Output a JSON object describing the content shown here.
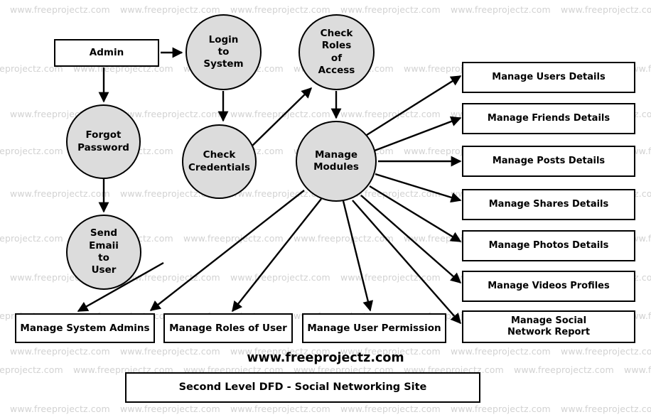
{
  "diagram": {
    "title": "Second Level DFD - Social Networking Site",
    "brand": "www.freeprojectz.com",
    "watermark_text": "www.freeprojectz.com",
    "colors": {
      "process_fill": "#dcdcdc",
      "stroke": "#000000",
      "background": "#ffffff",
      "watermark": "#d2d2d2"
    }
  },
  "nodes": {
    "admin": "Admin",
    "login_to_system": "Login\nto\nSystem",
    "check_roles_of_access": "Check\nRoles\nof\nAccess",
    "forgot_password": "Forgot\nPassword",
    "check_credentials": "Check\nCredentials",
    "manage_modules": "Manage\nModules",
    "send_email_to_user": "Send\nEmaii\nto\nUser"
  },
  "data_stores_right": [
    {
      "label": "Manage Users Details"
    },
    {
      "label": "Manage Friends Details"
    },
    {
      "label": "Manage Posts Details"
    },
    {
      "label": "Manage Shares Details"
    },
    {
      "label": "Manage Photos Details"
    },
    {
      "label": "Manage Videos Profiles"
    },
    {
      "label": "Manage Social\nNetwork Report"
    }
  ],
  "data_stores_bottom": [
    {
      "label": "Manage System Admins"
    },
    {
      "label": "Manage Roles of User"
    },
    {
      "label": "Manage User Permission"
    }
  ],
  "chart_data": {
    "type": "table",
    "title": "Second Level DFD - Social Networking Site",
    "processes": [
      "Login to System",
      "Check Roles of Access",
      "Forgot Password",
      "Check Credentials",
      "Manage Modules",
      "Send Emaii to User"
    ],
    "external_entities": [
      "Admin"
    ],
    "data_stores": [
      "Manage Users Details",
      "Manage Friends Details",
      "Manage Posts Details",
      "Manage Shares Details",
      "Manage Photos Details",
      "Manage Videos Profiles",
      "Manage Social Network Report",
      "Manage System Admins",
      "Manage Roles of User",
      "Manage User Permission"
    ],
    "flows": [
      {
        "from": "Admin",
        "to": "Login to System"
      },
      {
        "from": "Admin",
        "to": "Forgot Password"
      },
      {
        "from": "Login to System",
        "to": "Check Credentials"
      },
      {
        "from": "Check Credentials",
        "to": "Check Roles of Access"
      },
      {
        "from": "Check Roles of Access",
        "to": "Manage Modules"
      },
      {
        "from": "Forgot Password",
        "to": "Send Emaii to User"
      },
      {
        "from": "Send Emaii to User",
        "to": "Manage System Admins"
      },
      {
        "from": "Manage Modules",
        "to": "Manage Users Details"
      },
      {
        "from": "Manage Modules",
        "to": "Manage Friends Details"
      },
      {
        "from": "Manage Modules",
        "to": "Manage Posts Details"
      },
      {
        "from": "Manage Modules",
        "to": "Manage Shares Details"
      },
      {
        "from": "Manage Modules",
        "to": "Manage Photos Details"
      },
      {
        "from": "Manage Modules",
        "to": "Manage Videos Profiles"
      },
      {
        "from": "Manage Modules",
        "to": "Manage Social Network Report"
      },
      {
        "from": "Manage Modules",
        "to": "Manage System Admins"
      },
      {
        "from": "Manage Modules",
        "to": "Manage Roles of User"
      },
      {
        "from": "Manage Modules",
        "to": "Manage User Permission"
      }
    ]
  }
}
